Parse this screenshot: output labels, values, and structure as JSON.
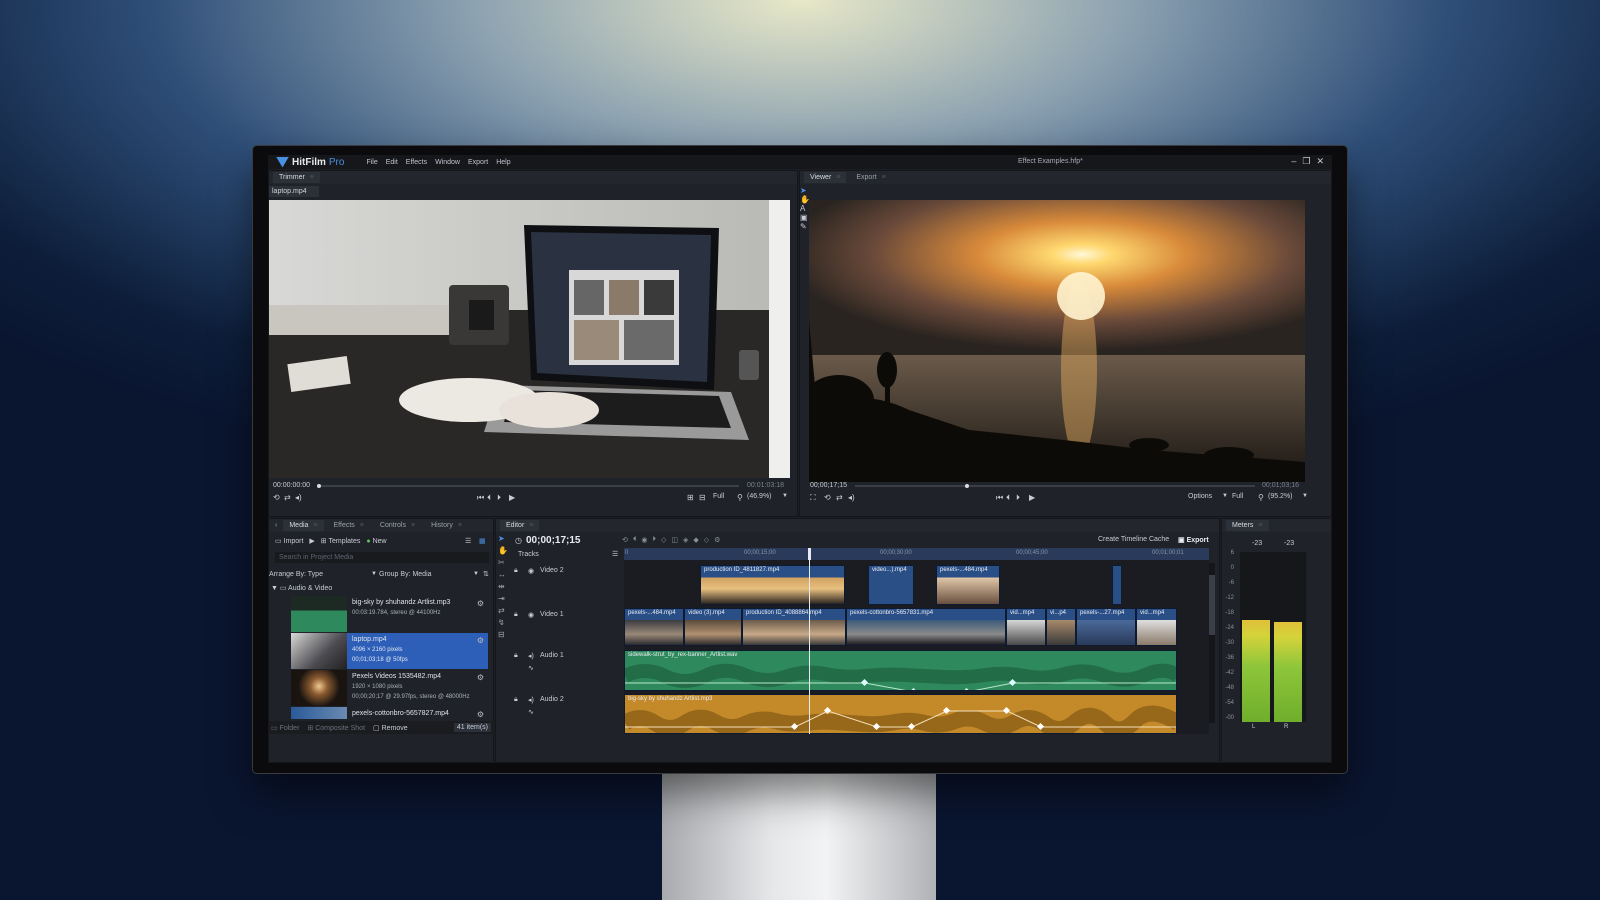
{
  "app": {
    "brand": "HitFilm",
    "edition": "Pro",
    "document_title": "Effect Examples.hfp*",
    "menu": [
      "File",
      "Edit",
      "Effects",
      "Window",
      "Export",
      "Help"
    ],
    "window_controls": [
      "–",
      "❐",
      "✕"
    ]
  },
  "trimmer": {
    "tab": "Trimmer",
    "filename": "laptop.mp4",
    "time_current": "00:00:00:00",
    "time_end": "00:01:03:18",
    "quality": "Full",
    "zoom": "(46.9%)",
    "playhead_fraction": 0.0
  },
  "viewer": {
    "tabs": [
      "Viewer",
      "Export"
    ],
    "time_current": "00;00;17;15",
    "time_end": "00;01;03;16",
    "options_label": "Options",
    "quality": "Full",
    "zoom": "(95.2%)",
    "playhead_fraction": 0.28
  },
  "media": {
    "tabs": [
      "Media",
      "Effects",
      "Controls",
      "History"
    ],
    "import_label": "Import",
    "templates_label": "Templates",
    "new_label": "New",
    "search_placeholder": "Search in Project Media",
    "arrange_label": "Arrange By: Type",
    "group_label": "Group By: Media",
    "folder_label": "Audio & Video",
    "items": [
      {
        "name": "big-sky by shuhandz Artlist.mp3",
        "detail1": "00:03:19.784, stereo @ 44100Hz",
        "detail2": "",
        "selected": false
      },
      {
        "name": "laptop.mp4",
        "detail1": "4096 × 2160 pixels",
        "detail2": "00;01;03;18 @ 50fps",
        "selected": true
      },
      {
        "name": "Pexels Videos 1535482.mp4",
        "detail1": "1920 × 1080 pixels",
        "detail2": "00;00;20;17 @ 29.97fps, stereo @ 48000Hz",
        "selected": false
      },
      {
        "name": "pexels-cottonbro-5657827.mp4",
        "detail1": "",
        "detail2": "",
        "selected": false
      }
    ],
    "footer": {
      "folder": "Folder",
      "composite": "Composite Shot",
      "remove": "Remove",
      "count": "41 item(s)"
    }
  },
  "editor": {
    "tab": "Editor",
    "timecode": "00;00;17;15",
    "tracks_label": "Tracks",
    "create_cache_label": "Create Timeline Cache",
    "export_label": "Export",
    "ruler": [
      "00;00;15;00",
      "00;00;30;00",
      "00;00;45;00",
      "00;01;00;01"
    ],
    "ruler_start": "0",
    "tracks": [
      {
        "name": "Video 2",
        "kind": "video"
      },
      {
        "name": "Video 1",
        "kind": "video"
      },
      {
        "name": "Audio 1",
        "kind": "audio"
      },
      {
        "name": "Audio 2",
        "kind": "audio"
      }
    ],
    "video2_clips": [
      "production ID_4811827.mp4",
      "video...).mp4",
      "pexels-...484.mp4"
    ],
    "video1_clips": [
      "pexels-...484.mp4",
      "video (3).mp4",
      "production ID_4088864.mp4",
      "pexels-cottonbro-5657831.mp4",
      "vid...mp4",
      "vi...p4",
      "pexels-...27.mp4",
      "vid...mp4"
    ],
    "audio1_clip": "sidewalk-strut_by_rex-banner_Artlist.wav",
    "audio2_clip": "big-sky by shuhandz Artlist.mp3",
    "playhead_seconds": 17.5
  },
  "meters": {
    "tab": "Meters",
    "peak_left": "-23",
    "peak_right": "-23",
    "scale": [
      "6",
      "0",
      "-6",
      "-12",
      "-18",
      "-24",
      "-30",
      "-36",
      "-42",
      "-48",
      "-54",
      "-00"
    ],
    "channels": [
      "L",
      "R"
    ],
    "level_left_fraction": 0.6,
    "level_right_fraction": 0.59
  },
  "colors": {
    "accent": "#4a90e2",
    "selection": "#2d5fb8",
    "audio1": "#2e8a5c",
    "audio2": "#c48a2a",
    "video_clip": "#2a4e86"
  }
}
